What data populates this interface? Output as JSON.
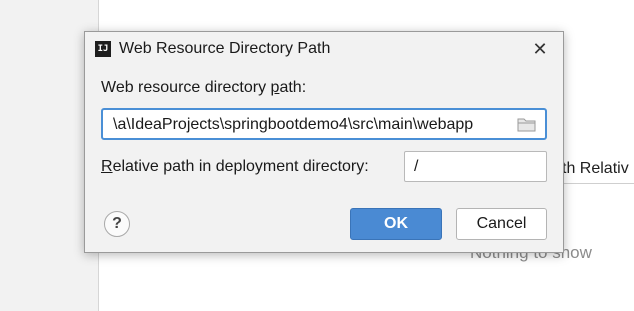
{
  "background": {
    "column_header_partial": "th Relativ",
    "empty_text": "Nothing to show"
  },
  "dialog": {
    "title": "Web Resource Directory Path",
    "path_label": "Web resource directory path:",
    "path_value": "\\a\\IdeaProjects\\springbootdemo4\\src\\main\\webapp",
    "relative_label": "Relative path in deployment directory:",
    "relative_value": "/",
    "help_glyph": "?",
    "ok_label": "OK",
    "cancel_label": "Cancel",
    "close_glyph": "✕",
    "icons": [
      "intellij-app-icon",
      "folder-icon",
      "close-icon",
      "help-icon"
    ],
    "accent_color": "#4a8ad3"
  }
}
